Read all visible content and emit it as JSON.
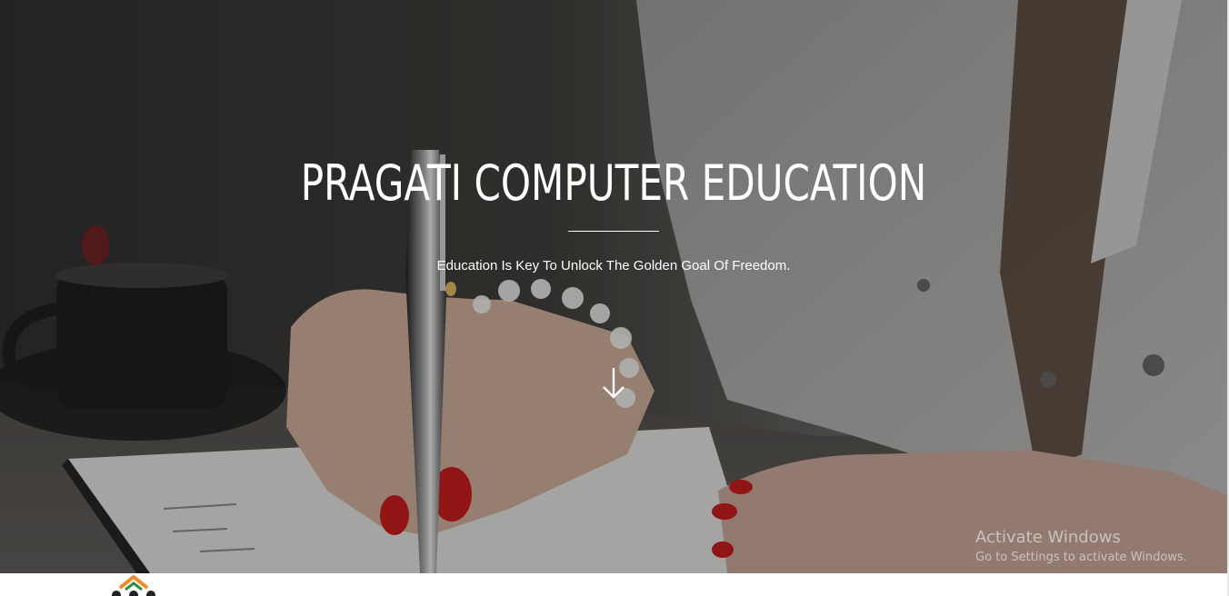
{
  "hero": {
    "title": "PRAGATI COMPUTER EDUCATION",
    "tagline": "Education Is Key To Unlock The Golden Goal Of Freedom.",
    "scroll_icon": "arrow-down-icon"
  },
  "watermark": {
    "line1": "Activate Windows",
    "line2": "Go to Settings to activate Windows."
  },
  "logo": {
    "icon": "pragati-logo-icon"
  },
  "colors": {
    "text": "#ffffff",
    "nail_red": "#c81d1d",
    "logo_orange": "#f08a24",
    "logo_green": "#2e8b3a"
  }
}
